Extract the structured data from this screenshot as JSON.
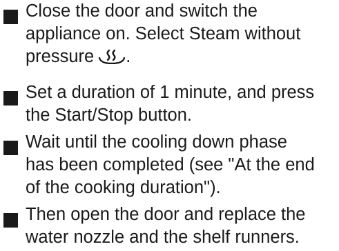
{
  "steps": [
    {
      "lines": [
        "Close the door and switch the",
        "appliance on. Select Steam without",
        "pressure"
      ],
      "trailing_punctuation": ".",
      "icon": "steam-without-pressure-icon"
    },
    {
      "lines": [
        "Set a duration of 1 minute, and press",
        "the Start/Stop button."
      ]
    },
    {
      "lines": [
        "Wait until the cooling down phase",
        "has been completed (see \"At the end",
        "of the cooking duration\")."
      ]
    },
    {
      "lines": [
        "Then open the door and replace the",
        "water nozzle and the shelf runners."
      ]
    }
  ],
  "colors": {
    "text": "#1a1a1a",
    "bullet": "#1a1a1a",
    "background": "#ffffff"
  }
}
